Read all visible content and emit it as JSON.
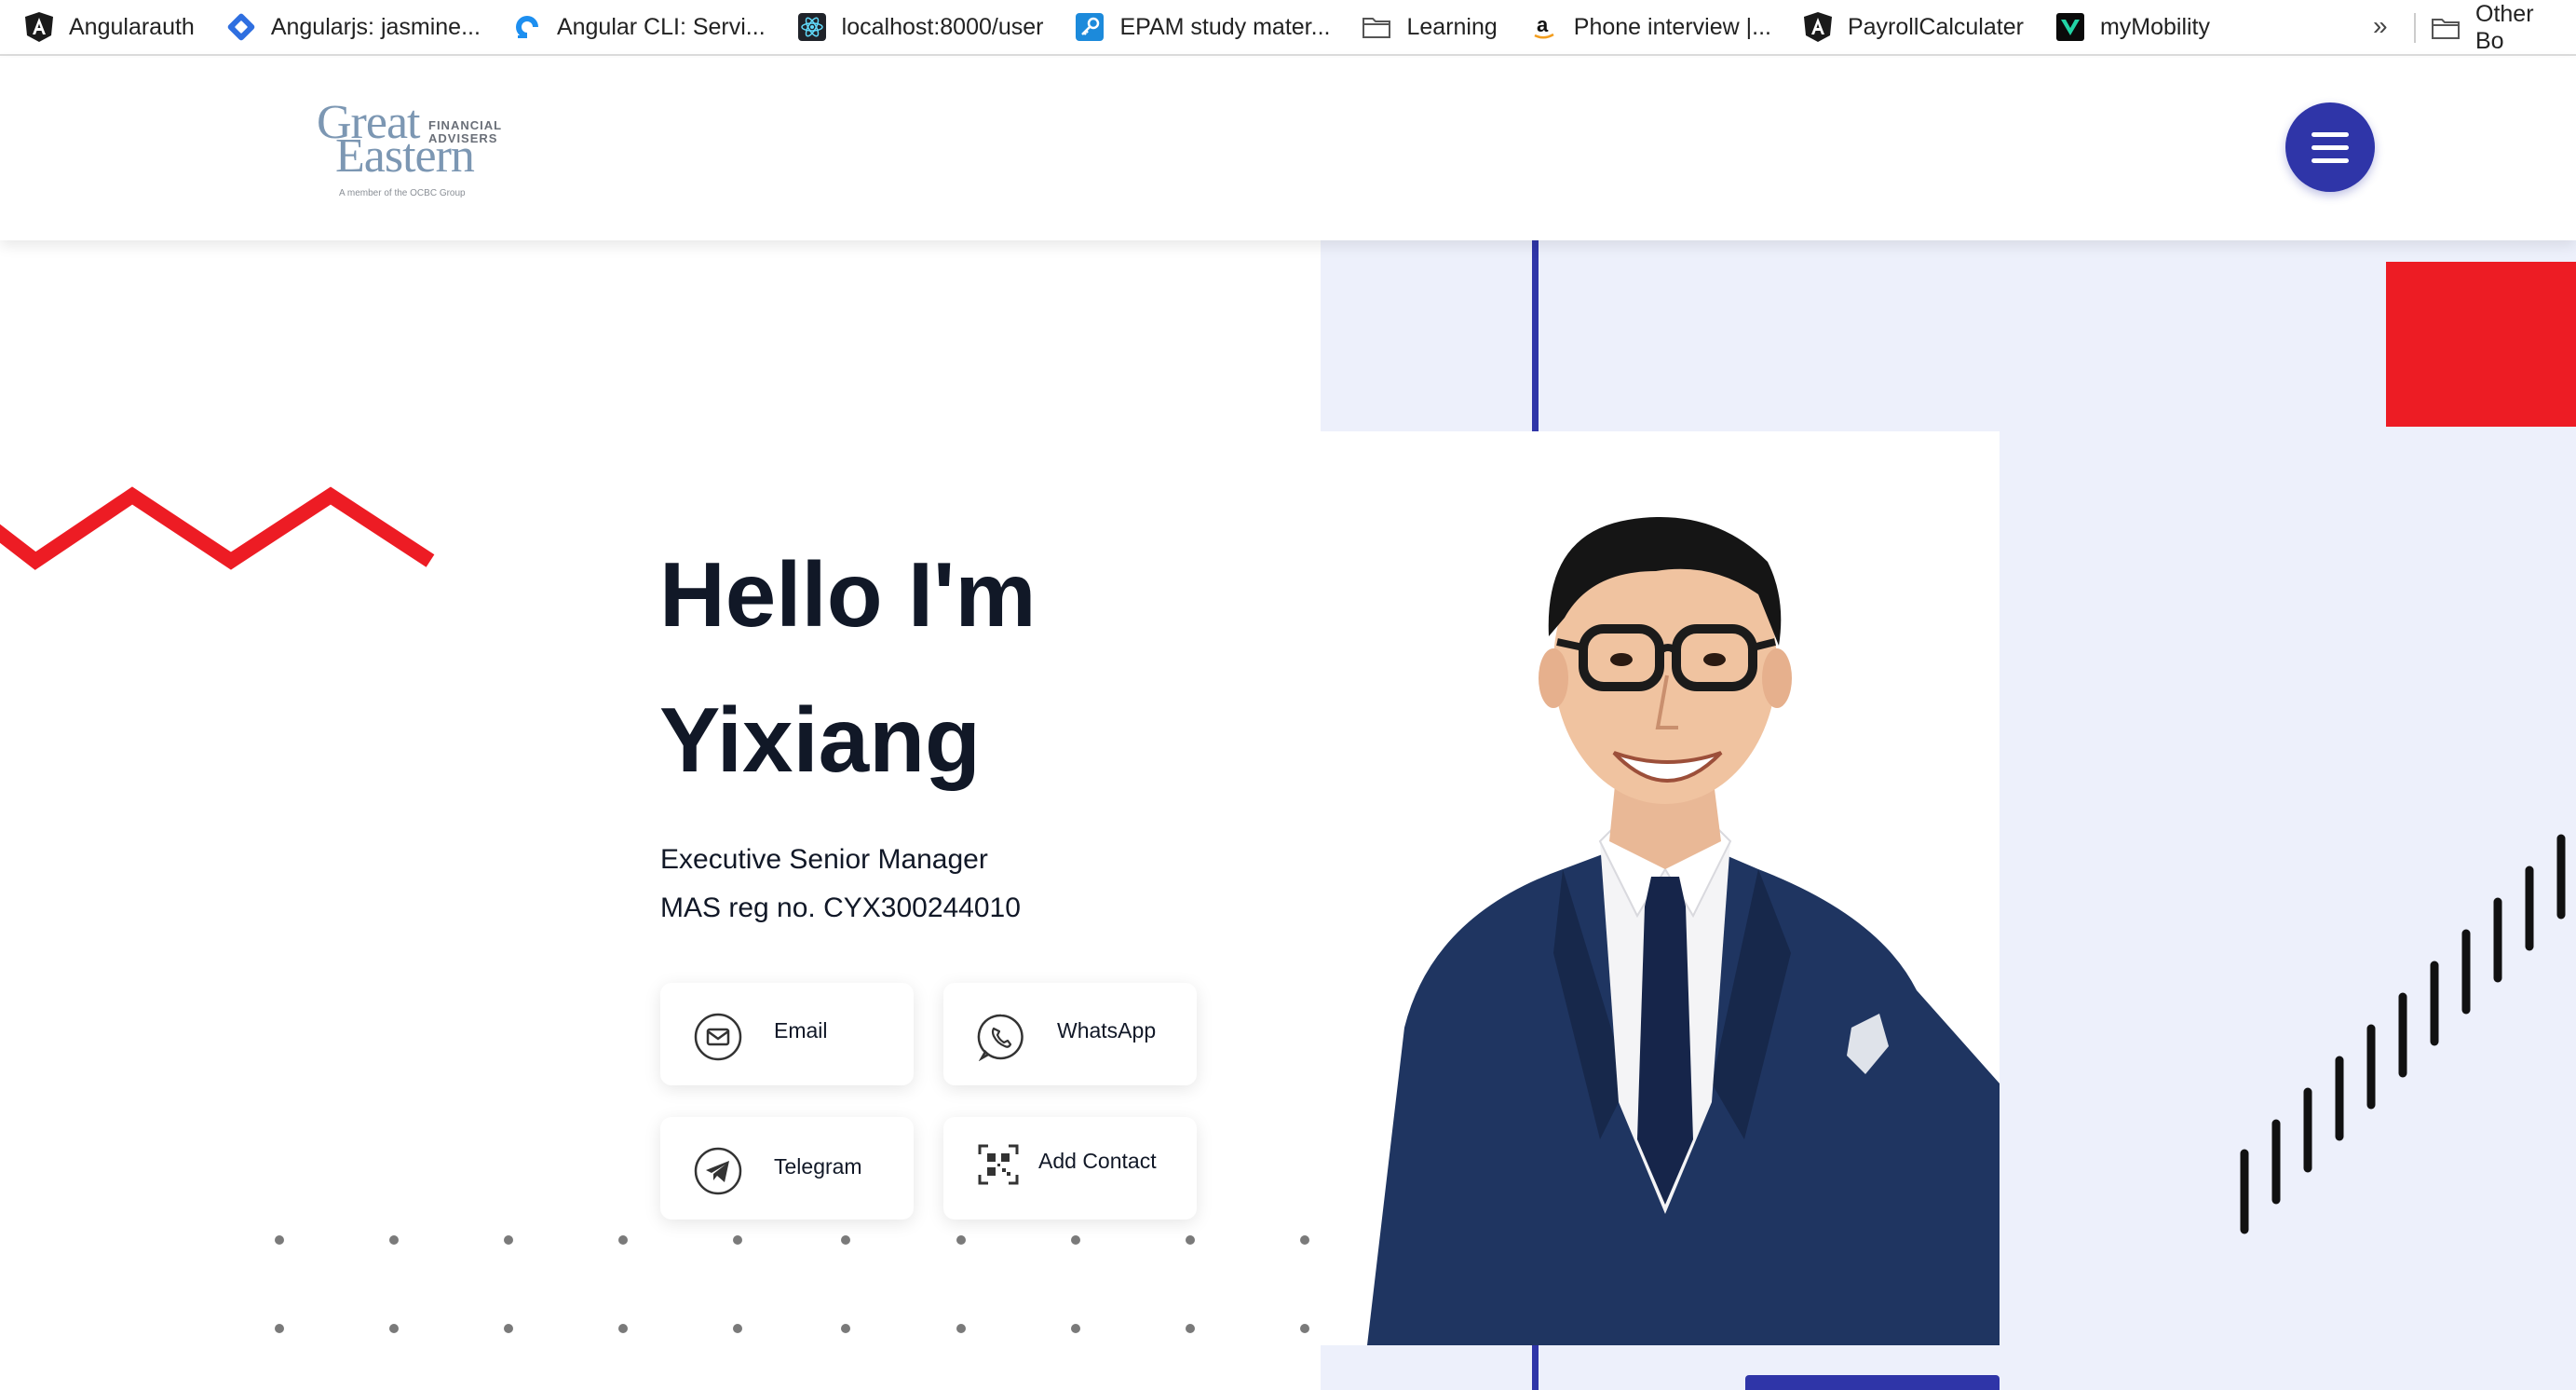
{
  "bookmarks": {
    "items": [
      {
        "label": "Angularauth",
        "icon": "angular-icon"
      },
      {
        "label": "Angularjs: jasmine...",
        "icon": "jira-icon"
      },
      {
        "label": "Angular CLI: Servi...",
        "icon": "digitalocean-icon"
      },
      {
        "label": "localhost:8000/user",
        "icon": "react-icon"
      },
      {
        "label": "EPAM study mater...",
        "icon": "key-icon"
      },
      {
        "label": "Learning",
        "icon": "folder-icon"
      },
      {
        "label": "Phone interview |...",
        "icon": "amazon-icon"
      },
      {
        "label": "PayrollCalculater",
        "icon": "angular-icon"
      },
      {
        "label": "myMobility",
        "icon": "veeva-icon"
      }
    ],
    "overflow": "»",
    "other": "Other Bo"
  },
  "header": {
    "logo": {
      "line1": "Great",
      "line2": "Eastern",
      "tag1": "FINANCIAL",
      "tag2": "ADVISERS",
      "member": "A member of the OCBC Group"
    },
    "menu_icon": "hamburger-icon"
  },
  "hero": {
    "greeting": "Hello I'm",
    "name": "Yixiang",
    "title": "Executive Senior Manager",
    "reg": "MAS reg no. CYX300244010"
  },
  "contacts": {
    "email": "Email",
    "whatsapp": "WhatsApp",
    "telegram": "Telegram",
    "add_contact": "Add Contact"
  },
  "colors": {
    "accent_blue": "#2f35a8",
    "accent_red": "#ed1c24",
    "lavender_bg": "#edf0fb",
    "text_dark": "#111827"
  }
}
